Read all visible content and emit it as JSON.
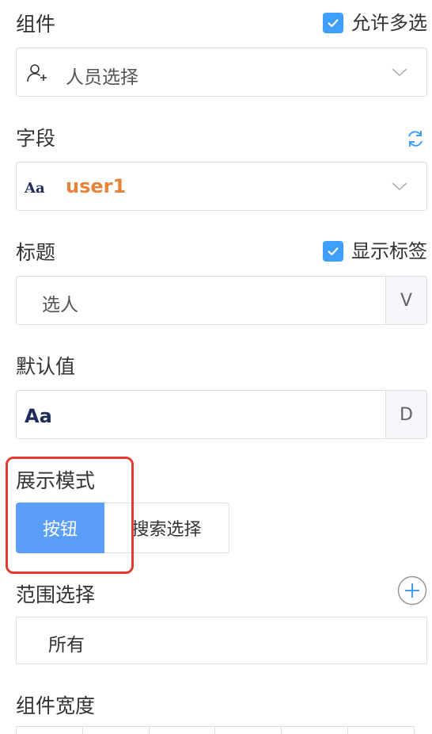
{
  "component": {
    "label": "组件",
    "allow_multi_label": "允许多选",
    "allow_multi_checked": true,
    "select_value": "人员选择",
    "icon": "user-add-icon"
  },
  "field": {
    "label": "字段",
    "refresh_icon": "refresh-icon",
    "type_icon_text": "Aa",
    "value": "user1",
    "value_color": "#e6833a"
  },
  "title": {
    "label": "标题",
    "show_label_text": "显示标签",
    "show_label_checked": true,
    "value": "选人",
    "addon": "V"
  },
  "default_value": {
    "label": "默认值",
    "value": "Aa",
    "addon": "D"
  },
  "display_mode": {
    "label": "展示模式",
    "options": [
      "按钮",
      "搜索选择"
    ],
    "selected": "按钮"
  },
  "range": {
    "label": "范围选择",
    "add_icon": "plus-circle-icon",
    "value": "所有"
  },
  "width": {
    "label": "组件宽度"
  },
  "colors": {
    "accent": "#409eff",
    "highlight": "#e5392f",
    "border": "#dcdfe6"
  }
}
